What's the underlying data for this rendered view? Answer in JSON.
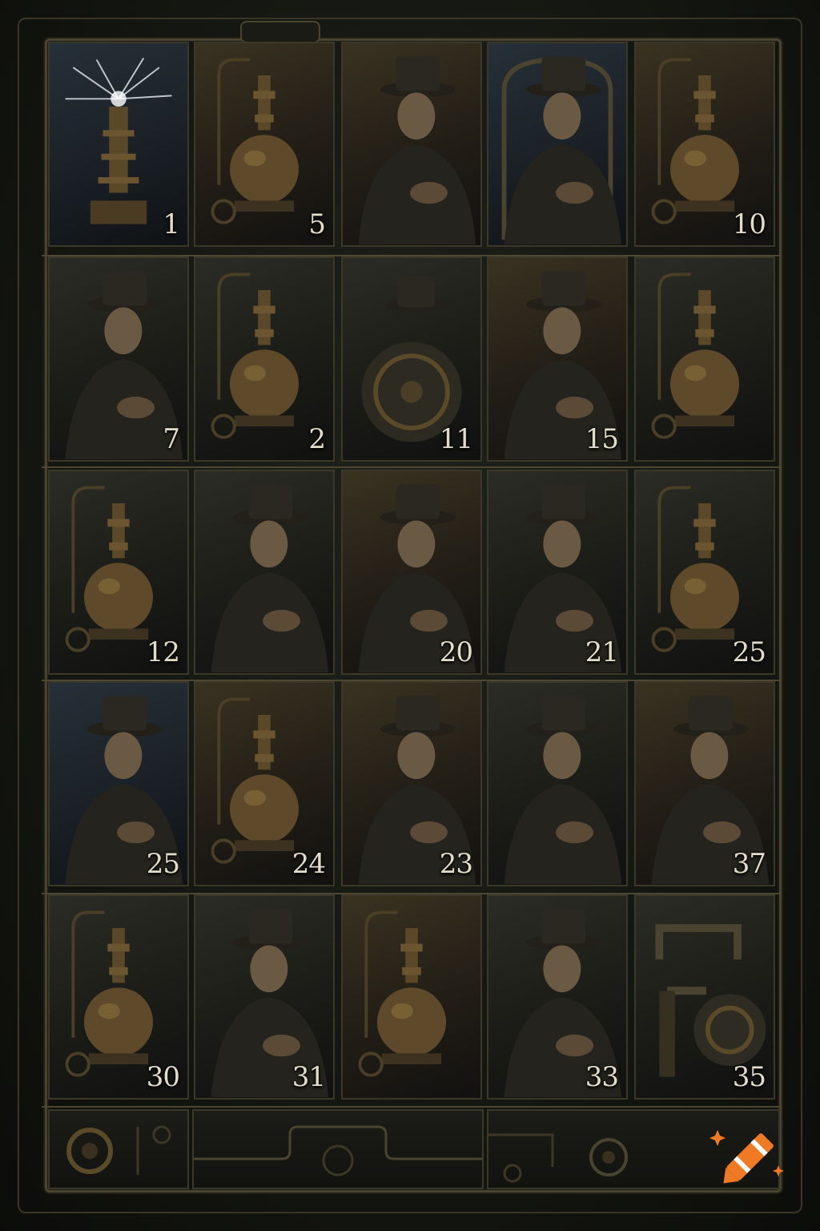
{
  "board": {
    "cards": [
      {
        "number": "1",
        "subject": "tesla-coil-icon",
        "tone": "blue"
      },
      {
        "number": "5",
        "subject": "flask-icon",
        "tone": "warm"
      },
      {
        "number": "",
        "subject": "man-in-hat-icon",
        "tone": "warm"
      },
      {
        "number": "",
        "subject": "man-in-window-icon",
        "tone": "blue"
      },
      {
        "number": "10",
        "subject": "flask-icon",
        "tone": "warm"
      },
      {
        "number": "7",
        "subject": "man-in-hat-icon",
        "tone": "plain"
      },
      {
        "number": "2",
        "subject": "flask-icon",
        "tone": "plain"
      },
      {
        "number": "11",
        "subject": "gear-wheel-icon",
        "tone": "plain"
      },
      {
        "number": "15",
        "subject": "man-in-hat-icon",
        "tone": "warm"
      },
      {
        "number": "",
        "subject": "flask-icon",
        "tone": "plain"
      },
      {
        "number": "12",
        "subject": "flask-icon",
        "tone": "plain"
      },
      {
        "number": "",
        "subject": "man-in-hat-icon",
        "tone": "plain"
      },
      {
        "number": "20",
        "subject": "man-in-hat-icon",
        "tone": "warm"
      },
      {
        "number": "21",
        "subject": "man-in-hat-icon",
        "tone": "plain"
      },
      {
        "number": "25",
        "subject": "flask-icon",
        "tone": "plain"
      },
      {
        "number": "25",
        "subject": "man-in-hat-icon",
        "tone": "blue"
      },
      {
        "number": "24",
        "subject": "flask-icon",
        "tone": "warm"
      },
      {
        "number": "23",
        "subject": "man-in-hat-icon",
        "tone": "warm"
      },
      {
        "number": "",
        "subject": "man-in-hat-icon",
        "tone": "plain"
      },
      {
        "number": "37",
        "subject": "man-in-hat-icon",
        "tone": "warm"
      },
      {
        "number": "30",
        "subject": "flask-icon",
        "tone": "plain"
      },
      {
        "number": "31",
        "subject": "man-in-hat-icon",
        "tone": "plain"
      },
      {
        "number": "",
        "subject": "flask-icon",
        "tone": "warm"
      },
      {
        "number": "33",
        "subject": "man-in-hat-icon",
        "tone": "plain"
      },
      {
        "number": "35",
        "subject": "pipe-machine-icon",
        "tone": "plain"
      }
    ]
  },
  "colors": {
    "background": "#141611",
    "brass": "#8a6f3e",
    "number_text": "#e4dccb",
    "logo_orange": "#f07a24"
  },
  "logo": {
    "name": "crayon-logo-icon"
  }
}
